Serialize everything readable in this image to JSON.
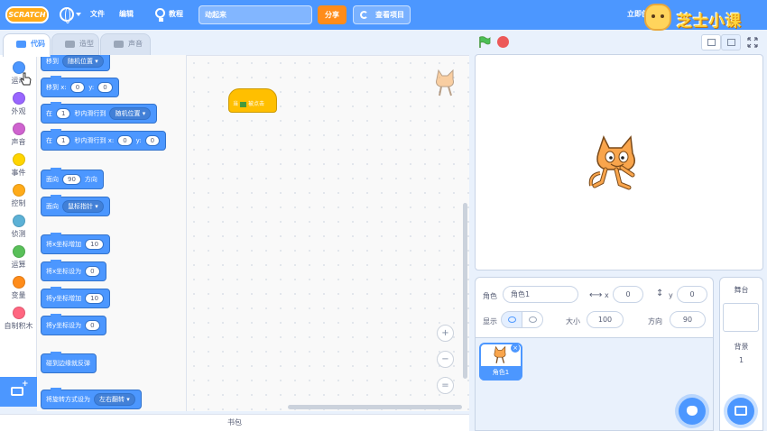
{
  "menubar": {
    "logo": "SCRATCH",
    "file": "文件",
    "edit": "编辑",
    "tutorials": "教程",
    "project_title": "动起来",
    "share": "分享",
    "see_project": "查看项目",
    "right_text": "立即创",
    "brand": "芝士小课"
  },
  "tabs": {
    "code": "代码",
    "costumes": "造型",
    "sounds": "声音"
  },
  "categories": [
    {
      "label": "运动",
      "color": "#4c97ff"
    },
    {
      "label": "外观",
      "color": "#9966ff"
    },
    {
      "label": "声音",
      "color": "#cf63cf"
    },
    {
      "label": "事件",
      "color": "#ffd500"
    },
    {
      "label": "控制",
      "color": "#ffab19"
    },
    {
      "label": "侦测",
      "color": "#5cb1d6"
    },
    {
      "label": "运算",
      "color": "#59c059"
    },
    {
      "label": "变量",
      "color": "#ff8c1a"
    },
    {
      "label": "自制积木",
      "color": "#ff6680"
    }
  ],
  "palette": {
    "goto_random": {
      "label": "移到",
      "drop": "随机位置"
    },
    "goto_xy": {
      "label": "移到 x:",
      "x": "0",
      "ylabel": "y:",
      "y": "0"
    },
    "glide_random": {
      "pre": "在",
      "secs": "1",
      "label": "秒内滑行到",
      "drop": "随机位置"
    },
    "glide_xy": {
      "pre": "在",
      "secs": "1",
      "label": "秒内滑行到 x:",
      "x": "0",
      "ylabel": "y:",
      "y": "0"
    },
    "point_dir": {
      "label": "面向",
      "value": "90",
      "suffix": "方向"
    },
    "point_towards": {
      "label": "面向",
      "drop": "鼠标指针"
    },
    "change_x": {
      "label": "将x坐标增加",
      "value": "10"
    },
    "set_x": {
      "label": "将x坐标设为",
      "value": "0"
    },
    "change_y": {
      "label": "将y坐标增加",
      "value": "10"
    },
    "set_y": {
      "label": "将y坐标设为",
      "value": "0"
    },
    "bounce": {
      "label": "碰到边缘就反弹"
    },
    "rotation_style": {
      "label": "将旋转方式设为",
      "drop": "左右翻转"
    }
  },
  "workspace": {
    "hat_block": {
      "pre": "当",
      "post": "被点击"
    },
    "zoom_in": "+",
    "zoom_out": "−",
    "zoom_reset": "="
  },
  "backpack": "书包",
  "sprite_info": {
    "sprite_label": "角色",
    "sprite_name": "角色1",
    "x_label": "x",
    "x_value": "0",
    "y_label": "y",
    "y_value": "0",
    "show_label": "显示",
    "size_label": "大小",
    "size_value": "100",
    "direction_label": "方向",
    "direction_value": "90"
  },
  "sprite_list": {
    "sprites": [
      {
        "name": "角色1"
      }
    ],
    "delete": "×"
  },
  "stage_pane": {
    "title": "舞台",
    "backdrops_label": "背景",
    "backdrops_count": "1"
  },
  "colors": {
    "menubar": "#4c97ff",
    "motion": "#4c97ff",
    "events": "#ffbf00",
    "share": "#ff8c1a",
    "stop": "#ec5959"
  }
}
